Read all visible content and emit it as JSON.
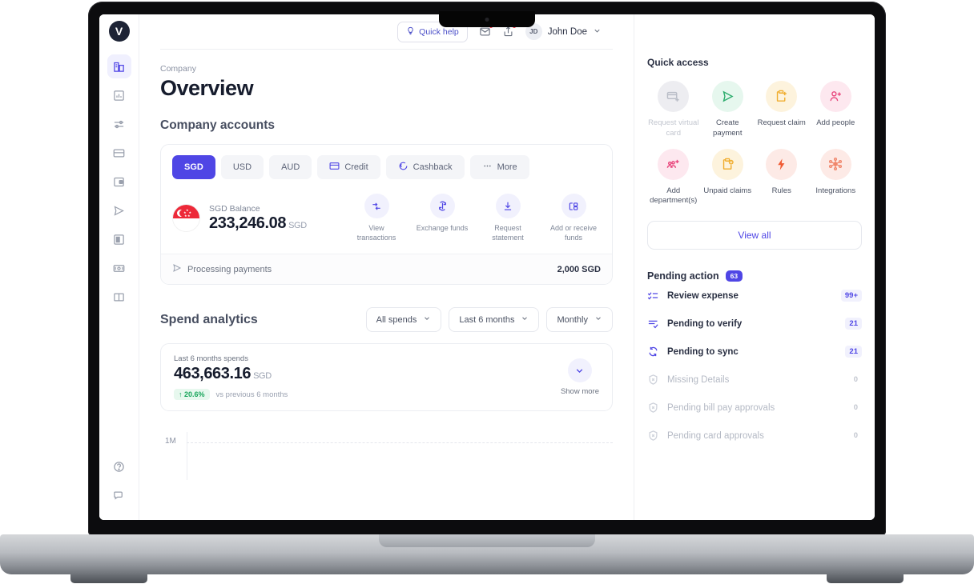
{
  "topbar": {
    "quick_help": "Quick help",
    "mail_icon": "mail-notification-icon",
    "share_icon": "share-notification-icon",
    "avatar_initials": "JD",
    "user_name": "John Doe",
    "chevron": "chevron-down-icon"
  },
  "sidebar": {
    "logo": "V",
    "items": [
      {
        "icon": "company-building-icon",
        "active": true
      },
      {
        "icon": "analytics-chart-icon",
        "active": false
      },
      {
        "icon": "settings-sliders-icon",
        "active": false
      },
      {
        "icon": "cards-icon",
        "active": false
      },
      {
        "icon": "wallet-icon",
        "active": false
      },
      {
        "icon": "send-payment-icon",
        "active": false
      },
      {
        "icon": "document-icon",
        "active": false
      },
      {
        "icon": "banknote-icon",
        "active": false
      },
      {
        "icon": "book-icon",
        "active": false
      }
    ],
    "bottom_items": [
      {
        "icon": "help-circle-icon"
      },
      {
        "icon": "chat-support-icon"
      }
    ]
  },
  "page": {
    "breadcrumb": "Company",
    "title": "Overview",
    "accounts_heading": "Company accounts"
  },
  "accounts": {
    "tabs": [
      {
        "label": "SGD",
        "icon": null,
        "active": true
      },
      {
        "label": "USD",
        "icon": null,
        "active": false
      },
      {
        "label": "AUD",
        "icon": null,
        "active": false
      },
      {
        "label": "Credit",
        "icon": "credit-card-icon",
        "active": false
      },
      {
        "label": "Cashback",
        "icon": "cashback-icon",
        "active": false
      },
      {
        "label": "More",
        "icon": "ellipsis-icon",
        "active": false
      }
    ],
    "balance_label": "SGD Balance",
    "balance_amount": "233,246.08",
    "balance_currency": "SGD",
    "flag": "singapore-flag",
    "actions": [
      {
        "label": "View transactions",
        "icon": "transactions-icon"
      },
      {
        "label": "Exchange funds",
        "icon": "exchange-icon"
      },
      {
        "label": "Request statement",
        "icon": "download-icon"
      },
      {
        "label": "Add or receive funds",
        "icon": "add-funds-icon"
      }
    ],
    "processing_label": "Processing payments",
    "processing_icon": "send-icon",
    "processing_amount": "2,000 SGD"
  },
  "spend": {
    "title": "Spend analytics",
    "filters": [
      {
        "label": "All spends"
      },
      {
        "label": "Last 6 months"
      },
      {
        "label": "Monthly"
      }
    ],
    "summary_label": "Last 6 months spends",
    "summary_amount": "463,663.16",
    "summary_currency": "SGD",
    "delta": "20.6%",
    "delta_arrow": "↑",
    "delta_caption": "vs previous 6 months",
    "show_more": "Show more",
    "show_more_icon": "chevron-down-icon"
  },
  "chart_data": {
    "type": "bar",
    "title": "Spend analytics",
    "categories": [],
    "values": [],
    "ytick_labels": [
      "1M"
    ],
    "xlabel": "",
    "ylabel": "",
    "grid": true
  },
  "quick_access": {
    "title": "Quick access",
    "items": [
      {
        "label": "Request virtual card",
        "icon": "request-virtual-card-icon",
        "bg": "#ededf1",
        "fg": "#b9bdc7",
        "disabled": true
      },
      {
        "label": "Create payment",
        "icon": "create-payment-icon",
        "bg": "#e6f7ee",
        "fg": "#2fad6e",
        "disabled": false
      },
      {
        "label": "Request claim",
        "icon": "request-claim-icon",
        "bg": "#fdf3dd",
        "fg": "#f0ad2e",
        "disabled": false
      },
      {
        "label": "Add people",
        "icon": "add-people-icon",
        "bg": "#fde8ef",
        "fg": "#e8467c",
        "disabled": false
      },
      {
        "label": "Add department(s)",
        "icon": "add-department-icon",
        "bg": "#fde8ef",
        "fg": "#e8467c",
        "disabled": false
      },
      {
        "label": "Unpaid claims",
        "icon": "unpaid-claims-icon",
        "bg": "#fdf3dd",
        "fg": "#f0ad2e",
        "disabled": false
      },
      {
        "label": "Rules",
        "icon": "rules-lightning-icon",
        "bg": "#fdeae6",
        "fg": "#f05a33",
        "disabled": false
      },
      {
        "label": "Integrations",
        "icon": "integrations-icon",
        "bg": "#fdeae6",
        "fg": "#f0866b",
        "disabled": false
      }
    ],
    "view_all": "View all"
  },
  "pending_action": {
    "title": "Pending action",
    "badge": "63",
    "rows": [
      {
        "label": "Review expense",
        "count": "99+",
        "icon": "review-expense-icon",
        "dim": false
      },
      {
        "label": "Pending to verify",
        "count": "21",
        "icon": "verify-icon",
        "dim": false
      },
      {
        "label": "Pending to sync",
        "count": "21",
        "icon": "sync-icon",
        "dim": false
      },
      {
        "label": "Missing Details",
        "count": "0",
        "icon": "shield-icon",
        "dim": true
      },
      {
        "label": "Pending bill pay approvals",
        "count": "0",
        "icon": "shield-icon",
        "dim": true
      },
      {
        "label": "Pending card approvals",
        "count": "0",
        "icon": "shield-icon",
        "dim": true
      }
    ]
  },
  "colors": {
    "accent": "#4f46e5",
    "accent_light": "#f1f1fd",
    "text_dark": "#161c2d",
    "text_muted": "#7e8697",
    "green": "#17a55a",
    "red_badge": "#f43f4e"
  }
}
